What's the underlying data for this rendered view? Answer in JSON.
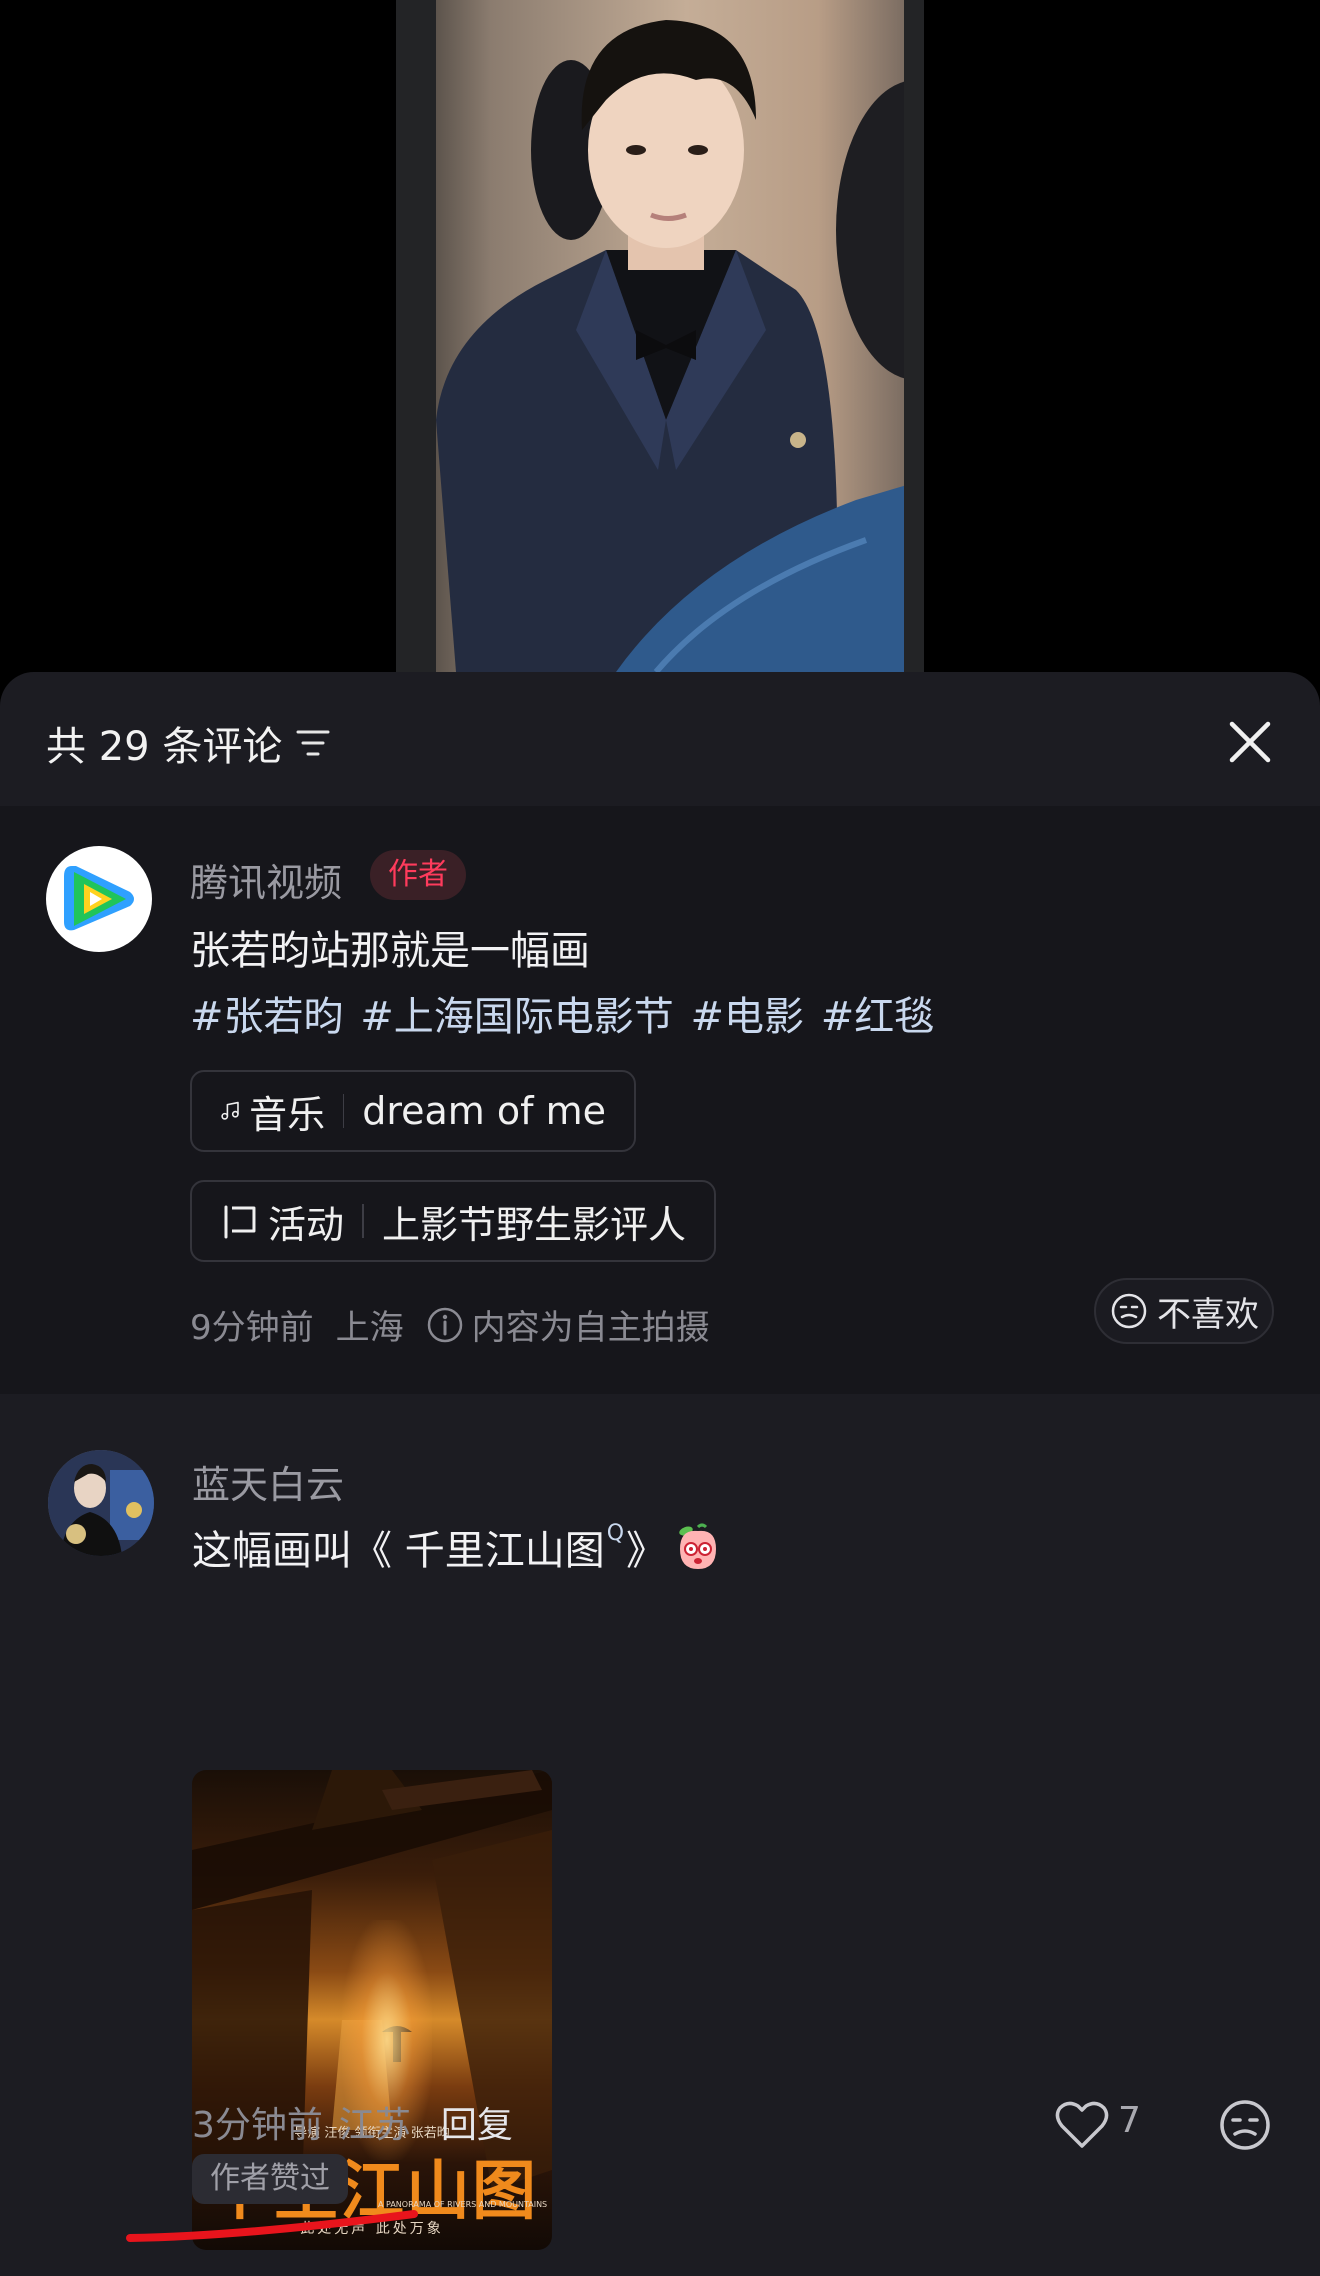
{
  "sheet": {
    "count_title": "共 29 条评论",
    "icons": {
      "sort": "sort-filter-icon",
      "close": "close-icon"
    }
  },
  "post": {
    "author_name": "腾讯视频",
    "author_badge": "作者",
    "text": "张若昀站那就是一幅画",
    "hashtags": "#张若昀 #上海国际电影节 #电影 #红毯",
    "music_chip": {
      "label": "音乐",
      "value": "dream of me",
      "icon": "music-note-icon"
    },
    "event_chip": {
      "label": "活动",
      "value": "上影节野生影评人",
      "icon": "event-flag-icon"
    },
    "meta": {
      "time": "9分钟前",
      "location": "上海",
      "notice": "内容为自主拍摄"
    },
    "dislike_label": "不喜欢"
  },
  "comment": {
    "user_name": "蓝天白云",
    "text_before": "这幅画叫《 千里江山图",
    "search_mark": "Q",
    "text_after": " 》",
    "poster": {
      "title": "千里江山图",
      "credits": "导演 汪俊    领衔主演 张若昀",
      "subtitle": "A PANORAMA OF RIVERS AND MOUNTAINS",
      "tagline": "此处无声    此处万象"
    },
    "meta": {
      "time": "3分钟前",
      "location": "江苏",
      "reply": "回复"
    },
    "like_count": "7",
    "liked_badge": "作者赞过"
  },
  "colors": {
    "accent_red": "#ff3b5c",
    "sheet_bg": "#1c1c22",
    "annotation_red": "#e8141c"
  }
}
